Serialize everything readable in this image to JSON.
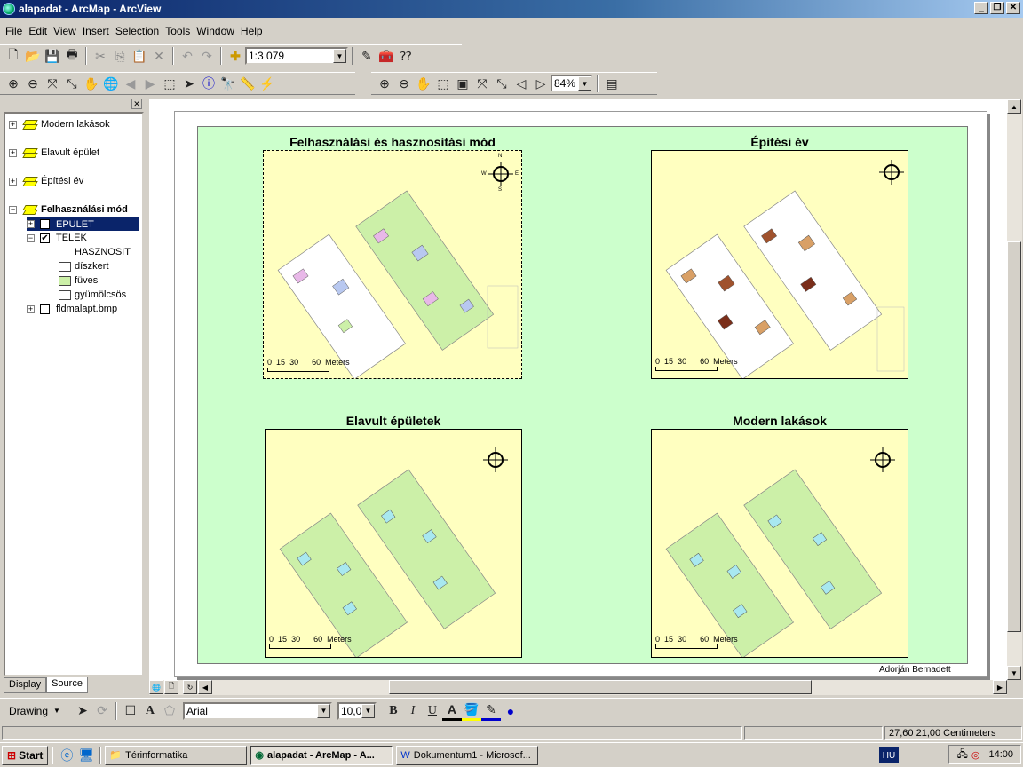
{
  "window": {
    "title": "alapadat - ArcMap - ArcView"
  },
  "menu": [
    "File",
    "Edit",
    "View",
    "Insert",
    "Selection",
    "Tools",
    "Window",
    "Help"
  ],
  "toolbar": {
    "scale": "1:3 079",
    "zoom": "84%"
  },
  "toc": {
    "layers": [
      "Modern lakások",
      "Elavult épület",
      "Építési év",
      "Felhasználási mód"
    ],
    "epulet": "EPULET",
    "telek": "TELEK",
    "hasznosit": "HASZNOSIT",
    "legend": [
      "díszkert",
      "füves",
      "gyümölcsös"
    ],
    "raster": "fldmalapt.bmp",
    "tabs": [
      "Display",
      "Source"
    ]
  },
  "layout": {
    "maps": [
      {
        "title": "Felhasználási és hasznosítási mód"
      },
      {
        "title": "Építési év"
      },
      {
        "title": "Elavult  épületek"
      },
      {
        "title": "Modern lakások"
      }
    ],
    "scale_ticks": [
      "0",
      "15",
      "30",
      "60",
      "Meters"
    ],
    "compass": {
      "n": "N",
      "s": "S",
      "e": "E",
      "w": "W"
    },
    "author": "Adorján Bernadett"
  },
  "drawing": {
    "label": "Drawing",
    "font": "Arial",
    "size": "10,0"
  },
  "status": {
    "coords": "27,60  21,00 Centimeters"
  },
  "taskbar": {
    "start": "Start",
    "tasks": [
      "Térinformatika",
      "alapadat - ArcMap - A...",
      "Dokumentum1 - Microsof..."
    ],
    "lang": "HU",
    "clock": "14:00"
  }
}
